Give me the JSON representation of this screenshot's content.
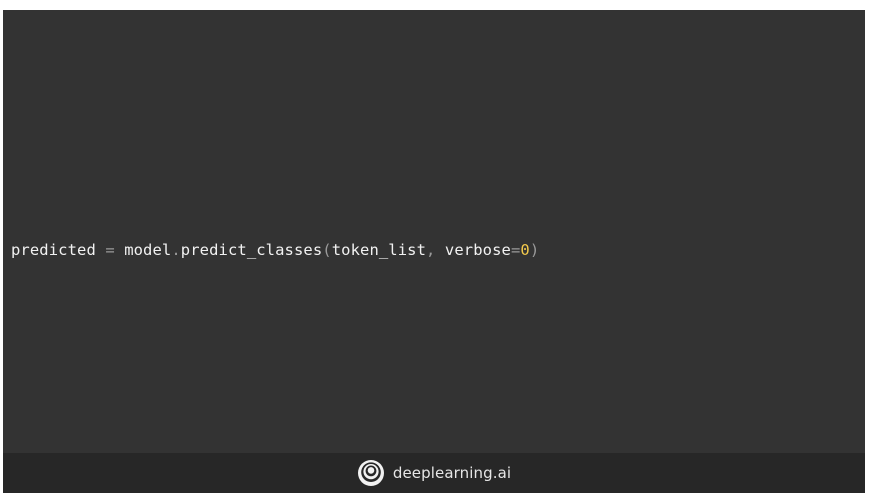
{
  "code": {
    "tokens": {
      "var": "predicted",
      "assign": " = ",
      "obj": "model",
      "dot": ".",
      "method": "predict_classes",
      "open_paren": "(",
      "arg1": "token_list",
      "comma": ", ",
      "kwarg": "verbose",
      "equals": "=",
      "num": "0",
      "close_paren": ")"
    }
  },
  "footer": {
    "brand": "deeplearning.ai",
    "logo_icon": "deeplearning-ai-logo-icon"
  },
  "colors": {
    "background": "#333333",
    "footer_background": "#272727",
    "code_text": "#f2f2f2",
    "punctuation": "#9a9a9a",
    "number": "#f2c94c"
  }
}
